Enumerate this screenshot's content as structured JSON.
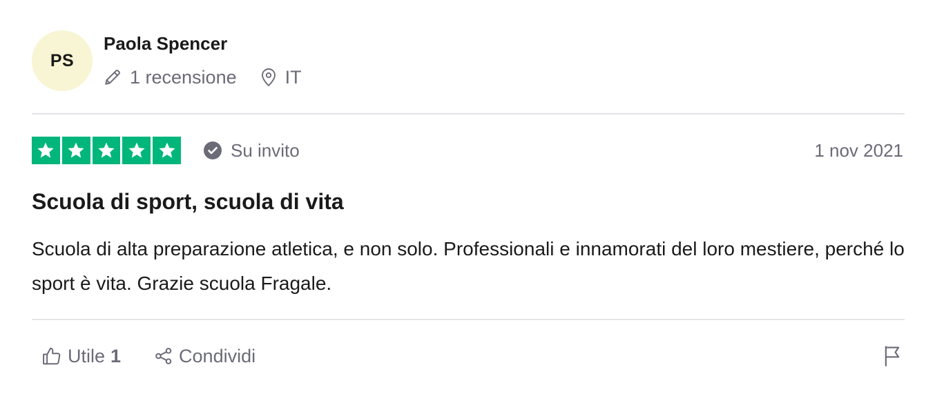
{
  "reviewer": {
    "initials": "PS",
    "name": "Paola Spencer",
    "reviews_count_label": "1 recensione",
    "country": "IT"
  },
  "review": {
    "rating": 5,
    "rating_max": 5,
    "invite_label": "Su invito",
    "date": "1 nov 2021",
    "title": "Scuola di sport, scuola di vita",
    "body": "Scuola di alta preparazione atletica, e non solo. Professionali e innamorati del loro mestiere, perché lo sport è vita. Grazie scuola Fragale."
  },
  "actions": {
    "useful_label": "Utile",
    "useful_count": "1",
    "share_label": "Condividi"
  },
  "colors": {
    "star_green": "#00b67a",
    "avatar_bg": "#f7f5d3",
    "muted_text": "#6b6b78",
    "divider": "#e4e4e8"
  },
  "icons": {
    "reviews": "pencil-icon",
    "location": "location-pin-icon",
    "invite": "check-circle-icon",
    "useful": "thumbs-up-icon",
    "share": "share-icon",
    "report": "flag-icon"
  }
}
